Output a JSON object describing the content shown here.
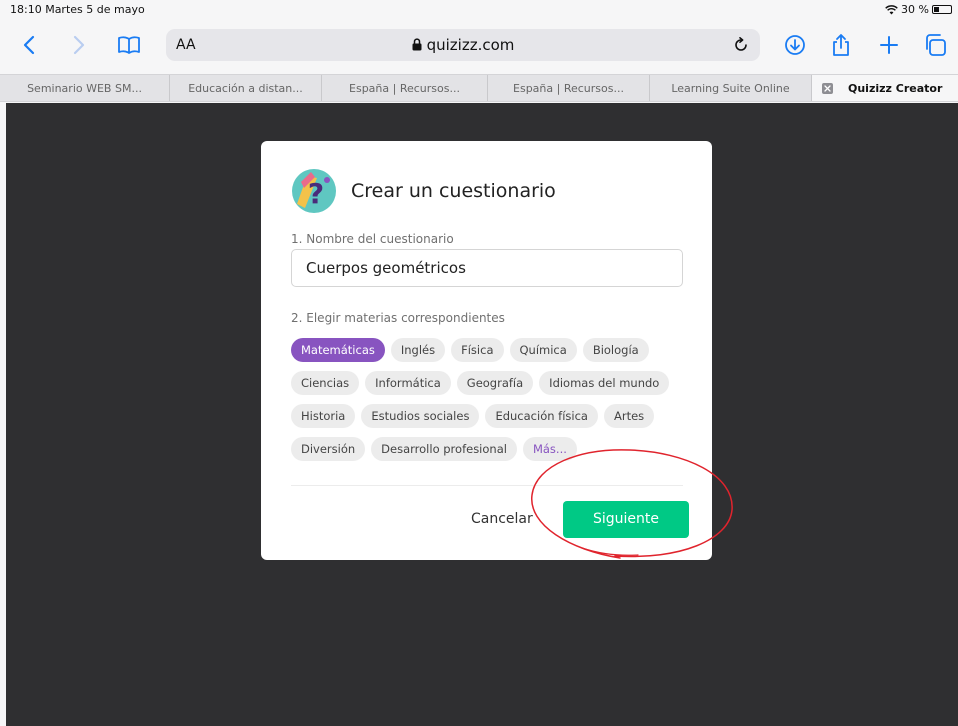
{
  "status": {
    "time_date": "18:10  Martes 5 de mayo",
    "battery": "30 %",
    "battery_fraction": 0.3
  },
  "toolbar": {
    "reader_label": "AA",
    "url": "quizizz.com"
  },
  "tabs": [
    {
      "label": "Seminario WEB SM..."
    },
    {
      "label": "Educación a distan..."
    },
    {
      "label": "España | Recursos..."
    },
    {
      "label": "España | Recursos..."
    },
    {
      "label": "Learning Suite Online"
    },
    {
      "label": "Quizizz Creator",
      "active": true
    }
  ],
  "modal": {
    "title": "Crear un cuestionario",
    "name_label": "1. Nombre del cuestionario",
    "name_value": "Cuerpos geométricos",
    "subjects_label": "2. Elegir materias correspondientes",
    "subject_rows": [
      [
        "Matemáticas",
        "Inglés",
        "Física",
        "Química",
        "Biología"
      ],
      [
        "Ciencias",
        "Informática",
        "Geografía",
        "Idiomas del mundo"
      ],
      [
        "Historia",
        "Estudios sociales",
        "Educación física",
        "Artes"
      ],
      [
        "Diversión",
        "Desarrollo profesional",
        "Más..."
      ]
    ],
    "selected_subject": "Matemáticas",
    "more_label": "Más...",
    "cancel_label": "Cancelar",
    "next_label": "Siguiente"
  },
  "colors": {
    "accent_purple": "#8854c0",
    "button_green": "#00c985",
    "ios_blue": "#1a7cf3",
    "page_bg": "#2f2f31",
    "annotation_red": "#e0242d"
  }
}
